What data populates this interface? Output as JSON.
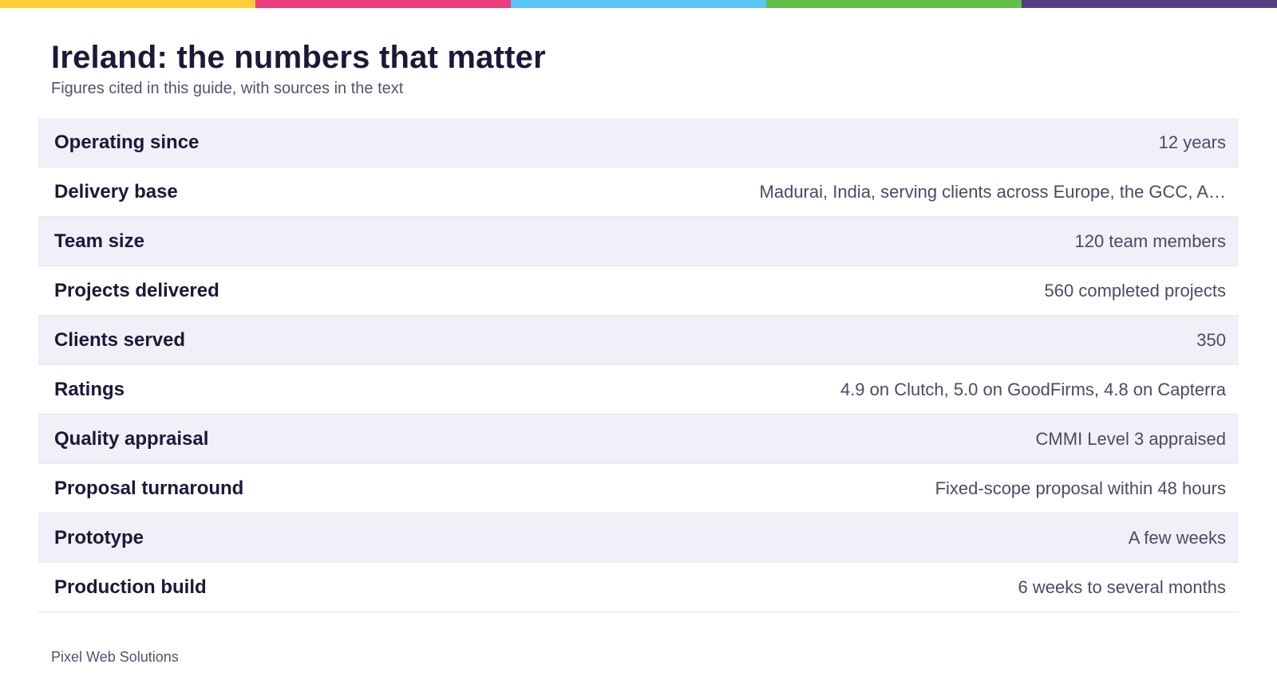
{
  "colors": {
    "stripe": [
      "#fecd3a",
      "#ec3e7c",
      "#5ac5f2",
      "#62be49",
      "#553d7f"
    ],
    "row_alt": "#f1eff8",
    "heading": "#1c1838",
    "muted": "#57506e"
  },
  "header": {
    "title": "Ireland: the numbers that matter",
    "subtitle": "Figures cited in this guide, with sources in the text"
  },
  "facts": [
    {
      "label": "Operating since",
      "value": "12 years"
    },
    {
      "label": "Delivery base",
      "value": "Madurai, India, serving clients across Europe, the GCC, A…"
    },
    {
      "label": "Team size",
      "value": "120 team members"
    },
    {
      "label": "Projects delivered",
      "value": "560 completed projects"
    },
    {
      "label": "Clients served",
      "value": "350"
    },
    {
      "label": "Ratings",
      "value": "4.9 on Clutch, 5.0 on GoodFirms, 4.8 on Capterra"
    },
    {
      "label": "Quality appraisal",
      "value": "CMMI Level 3 appraised"
    },
    {
      "label": "Proposal turnaround",
      "value": "Fixed-scope proposal within 48 hours"
    },
    {
      "label": "Prototype",
      "value": "A few weeks"
    },
    {
      "label": "Production build",
      "value": "6 weeks to several months"
    }
  ],
  "footer": {
    "brand": "Pixel Web Solutions"
  }
}
